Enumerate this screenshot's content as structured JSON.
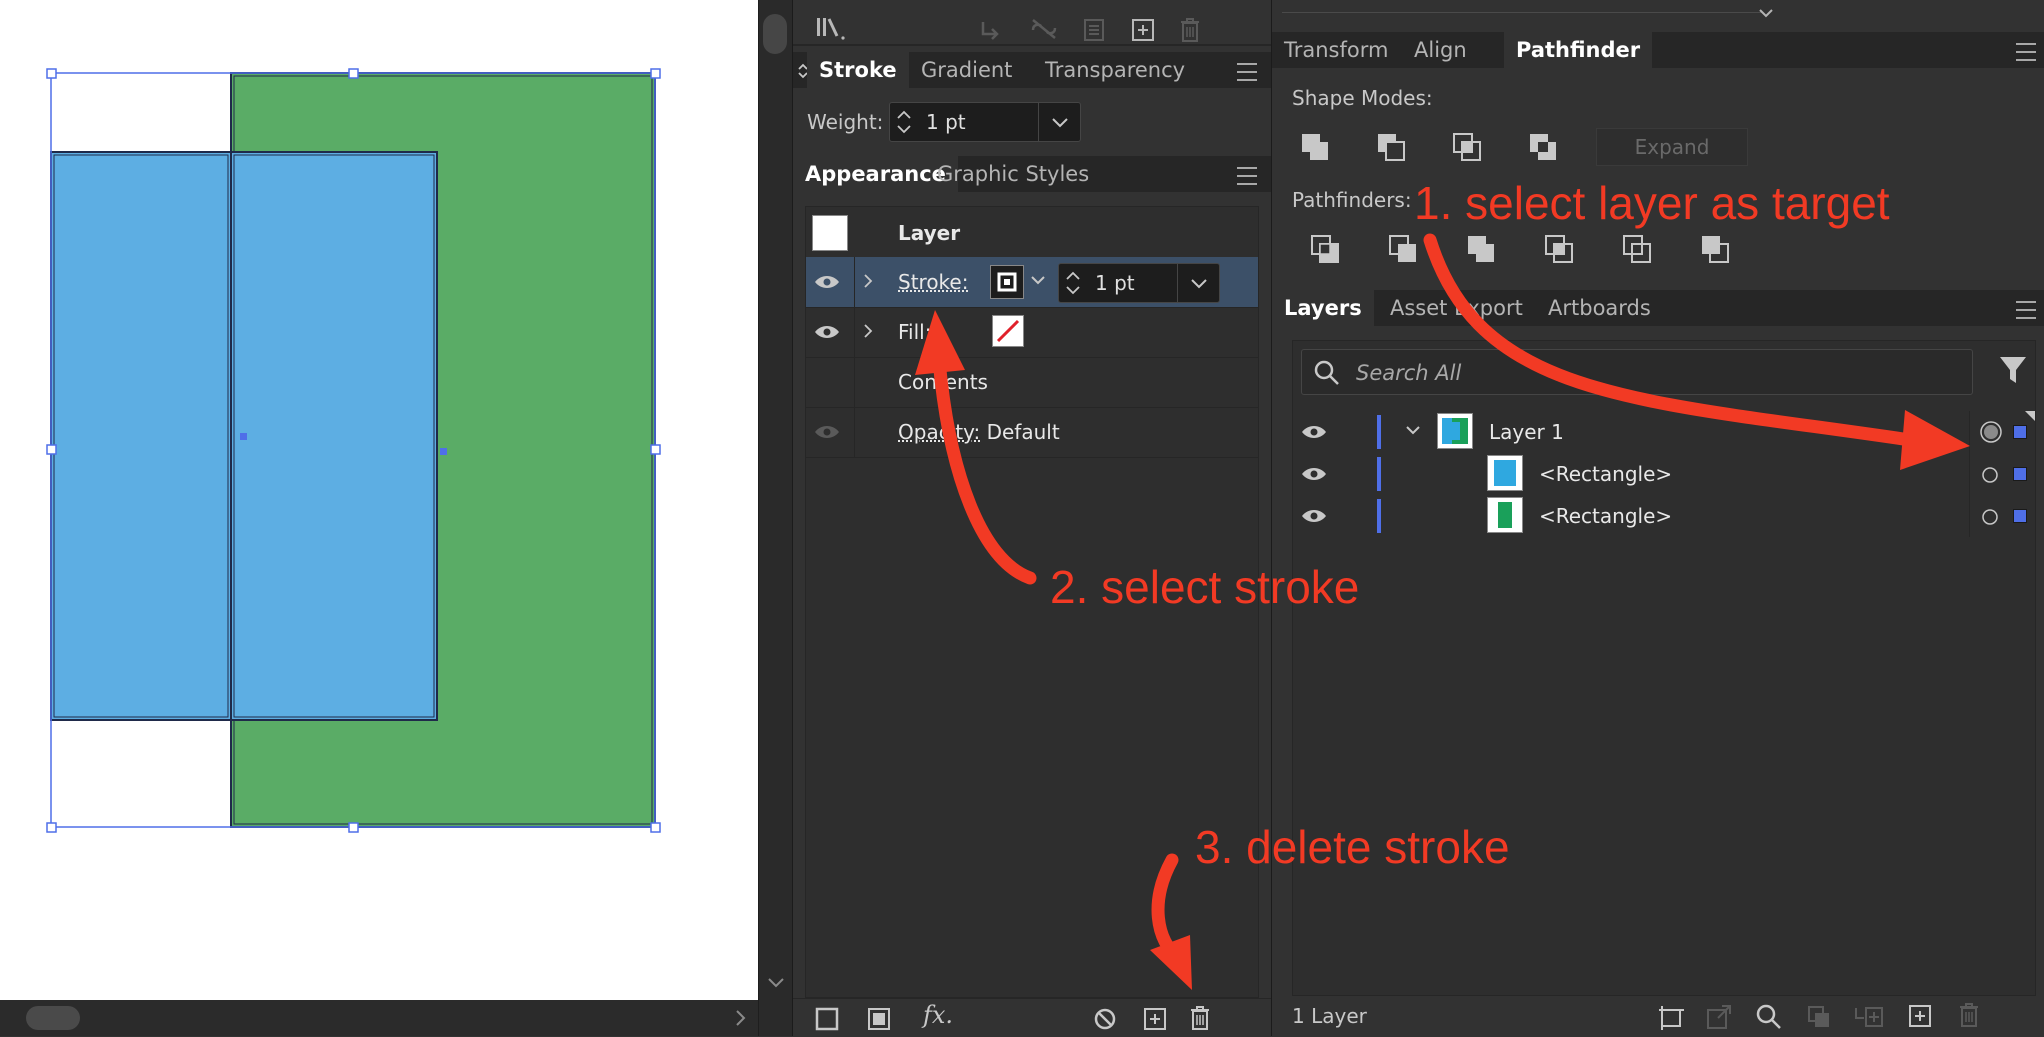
{
  "mid_top": {
    "dropdown_hint": "."
  },
  "stroke_panel": {
    "tabs": [
      "Stroke",
      "Gradient",
      "Transparency"
    ],
    "weight_label": "Weight:",
    "weight_value": "1 pt"
  },
  "appearance_panel": {
    "tabs": [
      "Appearance",
      "Graphic Styles"
    ],
    "target_label": "Layer",
    "rows": [
      {
        "label": "Stroke:",
        "value": "1 pt"
      },
      {
        "label": "Fill:"
      },
      {
        "label": "Contents"
      },
      {
        "label": "Opacity:",
        "value": "Default"
      }
    ],
    "fx_label": "fx."
  },
  "pathfinder_panel": {
    "tabs": [
      "Transform",
      "Align",
      "Pathfinder"
    ],
    "shape_modes_label": "Shape Modes:",
    "expand_label": "Expand",
    "pathfinders_label": "Pathfinders:"
  },
  "layers_panel": {
    "tabs": [
      "Layers",
      "Asset Export",
      "Artboards"
    ],
    "search_placeholder": "Search All",
    "items": [
      {
        "name": "Layer 1"
      },
      {
        "name": "<Rectangle>"
      },
      {
        "name": "<Rectangle>"
      }
    ],
    "footer_count": "1 Layer"
  },
  "annotations": {
    "step1": "1. select layer as target",
    "step2": "2. select stroke",
    "step3": "3. delete stroke"
  },
  "colors": {
    "blue_rect": "#5daee3",
    "green_rect": "#5aac66",
    "selection": "#4f6fe8",
    "annotation": "#f23a24",
    "highlight_row": "#3c5068"
  }
}
